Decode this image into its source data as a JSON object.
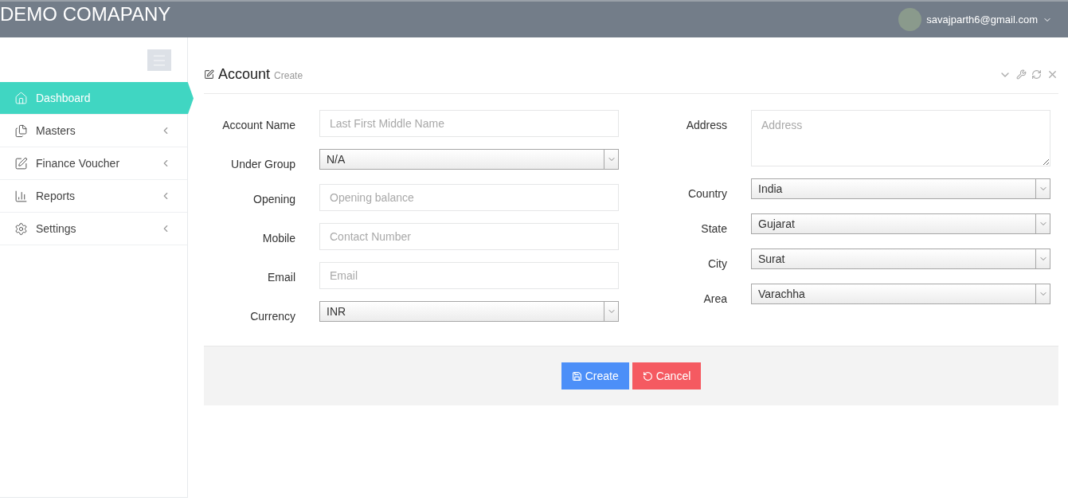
{
  "header": {
    "brand": "DEMO COMAPANY",
    "user": "savajparth6@gmail.com"
  },
  "sidebar": {
    "items": [
      {
        "label": "Dashboard",
        "kind": "link",
        "selected": true
      },
      {
        "label": "Masters",
        "kind": "submenu",
        "selected": false,
        "expanded": false
      },
      {
        "label": "Finance Voucher",
        "kind": "submenu",
        "selected": false,
        "expanded": false
      },
      {
        "label": "Reports",
        "kind": "submenu",
        "selected": false,
        "expanded": false
      },
      {
        "label": "Settings",
        "kind": "submenu",
        "selected": false,
        "expanded": false
      }
    ]
  },
  "panel": {
    "title": "Account",
    "subtitle": "Create",
    "left_fields": [
      {
        "label": "Account Name",
        "kind": "input",
        "placeholder": "Last First Middle Name"
      },
      {
        "label": "Under Group",
        "kind": "select",
        "value": "N/A"
      },
      {
        "label": "Opening",
        "kind": "input",
        "placeholder": "Opening balance"
      },
      {
        "label": "Mobile",
        "kind": "input",
        "placeholder": "Contact Number"
      },
      {
        "label": "Email",
        "kind": "input",
        "placeholder": "Email"
      },
      {
        "label": "Currency",
        "kind": "select",
        "value": "INR"
      }
    ],
    "right_fields": [
      {
        "label": "Address",
        "kind": "textarea",
        "placeholder": "Address"
      },
      {
        "label": "Country",
        "kind": "select",
        "value": "India"
      },
      {
        "label": "State",
        "kind": "select",
        "value": "Gujarat"
      },
      {
        "label": "City",
        "kind": "select",
        "value": "Surat"
      },
      {
        "label": "Area",
        "kind": "select",
        "value": "Varachha"
      }
    ],
    "buttons": [
      {
        "label": "Create",
        "kind": "primary"
      },
      {
        "label": "Cancel",
        "kind": "danger"
      }
    ]
  }
}
